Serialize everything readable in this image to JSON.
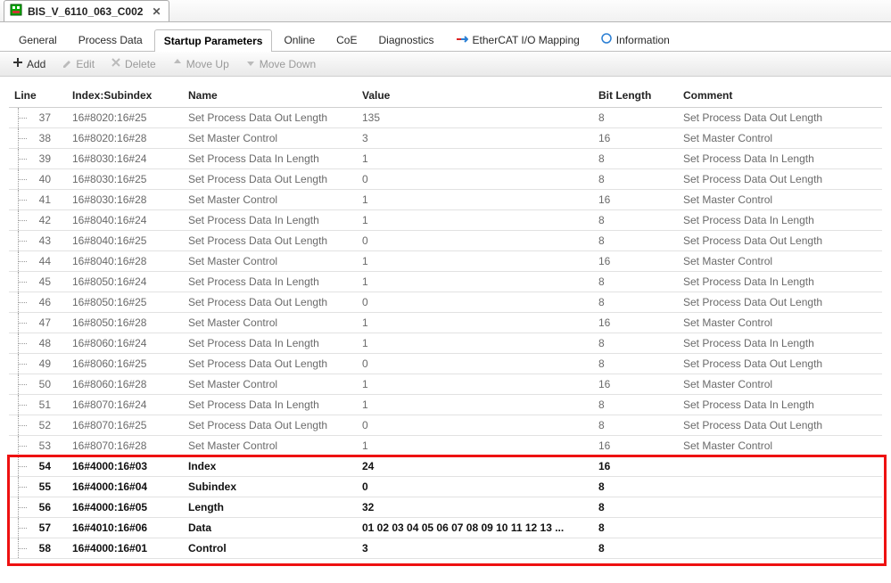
{
  "doc_tab": {
    "title": "BIS_V_6110_063_C002"
  },
  "tabs": [
    {
      "label": "General"
    },
    {
      "label": "Process Data"
    },
    {
      "label": "Startup Parameters"
    },
    {
      "label": "Online"
    },
    {
      "label": "CoE"
    },
    {
      "label": "Diagnostics"
    },
    {
      "label": "EtherCAT I/O Mapping"
    },
    {
      "label": "Information"
    }
  ],
  "active_tab": 2,
  "toolbar": {
    "add": "Add",
    "edit": "Edit",
    "delete": "Delete",
    "move_up": "Move Up",
    "move_down": "Move Down"
  },
  "columns": [
    "Line",
    "Index:Subindex",
    "Name",
    "Value",
    "Bit Length",
    "Comment"
  ],
  "rows": [
    {
      "line": "37",
      "idx": "16#8020:16#25",
      "name": "Set Process Data Out Length",
      "val": "135",
      "bit": "8",
      "com": "Set Process Data Out Length"
    },
    {
      "line": "38",
      "idx": "16#8020:16#28",
      "name": "Set Master Control",
      "val": "3",
      "bit": "16",
      "com": "Set Master Control"
    },
    {
      "line": "39",
      "idx": "16#8030:16#24",
      "name": "Set Process Data In Length",
      "val": "1",
      "bit": "8",
      "com": "Set Process Data In Length"
    },
    {
      "line": "40",
      "idx": "16#8030:16#25",
      "name": "Set Process Data Out Length",
      "val": "0",
      "bit": "8",
      "com": "Set Process Data Out Length"
    },
    {
      "line": "41",
      "idx": "16#8030:16#28",
      "name": "Set Master Control",
      "val": "1",
      "bit": "16",
      "com": "Set Master Control"
    },
    {
      "line": "42",
      "idx": "16#8040:16#24",
      "name": "Set Process Data In Length",
      "val": "1",
      "bit": "8",
      "com": "Set Process Data In Length"
    },
    {
      "line": "43",
      "idx": "16#8040:16#25",
      "name": "Set Process Data Out Length",
      "val": "0",
      "bit": "8",
      "com": "Set Process Data Out Length"
    },
    {
      "line": "44",
      "idx": "16#8040:16#28",
      "name": "Set Master Control",
      "val": "1",
      "bit": "16",
      "com": "Set Master Control"
    },
    {
      "line": "45",
      "idx": "16#8050:16#24",
      "name": "Set Process Data In Length",
      "val": "1",
      "bit": "8",
      "com": "Set Process Data In Length"
    },
    {
      "line": "46",
      "idx": "16#8050:16#25",
      "name": "Set Process Data Out Length",
      "val": "0",
      "bit": "8",
      "com": "Set Process Data Out Length"
    },
    {
      "line": "47",
      "idx": "16#8050:16#28",
      "name": "Set Master Control",
      "val": "1",
      "bit": "16",
      "com": "Set Master Control"
    },
    {
      "line": "48",
      "idx": "16#8060:16#24",
      "name": "Set Process Data In Length",
      "val": "1",
      "bit": "8",
      "com": "Set Process Data In Length"
    },
    {
      "line": "49",
      "idx": "16#8060:16#25",
      "name": "Set Process Data Out Length",
      "val": "0",
      "bit": "8",
      "com": "Set Process Data Out Length"
    },
    {
      "line": "50",
      "idx": "16#8060:16#28",
      "name": "Set Master Control",
      "val": "1",
      "bit": "16",
      "com": "Set Master Control"
    },
    {
      "line": "51",
      "idx": "16#8070:16#24",
      "name": "Set Process Data In Length",
      "val": "1",
      "bit": "8",
      "com": "Set Process Data In Length"
    },
    {
      "line": "52",
      "idx": "16#8070:16#25",
      "name": "Set Process Data Out Length",
      "val": "0",
      "bit": "8",
      "com": "Set Process Data Out Length"
    },
    {
      "line": "53",
      "idx": "16#8070:16#28",
      "name": "Set Master Control",
      "val": "1",
      "bit": "16",
      "com": "Set Master Control"
    },
    {
      "line": "54",
      "idx": "16#4000:16#03",
      "name": "Index",
      "val": "24",
      "bit": "16",
      "com": "",
      "hl": true
    },
    {
      "line": "55",
      "idx": "16#4000:16#04",
      "name": "Subindex",
      "val": "0",
      "bit": "8",
      "com": "",
      "hl": true
    },
    {
      "line": "56",
      "idx": "16#4000:16#05",
      "name": "Length",
      "val": "32",
      "bit": "8",
      "com": "",
      "hl": true
    },
    {
      "line": "57",
      "idx": "16#4010:16#06",
      "name": "Data",
      "val": "01 02 03 04 05 06 07 08 09 10 11 12 13 ...",
      "bit": "8",
      "com": "",
      "hl": true
    },
    {
      "line": "58",
      "idx": "16#4000:16#01",
      "name": "Control",
      "val": "3",
      "bit": "8",
      "com": "",
      "hl": true
    }
  ],
  "icons": {
    "ecat_colors": [
      "#d22",
      "#2a7fd4"
    ],
    "info_color": "#2a7fd4"
  }
}
